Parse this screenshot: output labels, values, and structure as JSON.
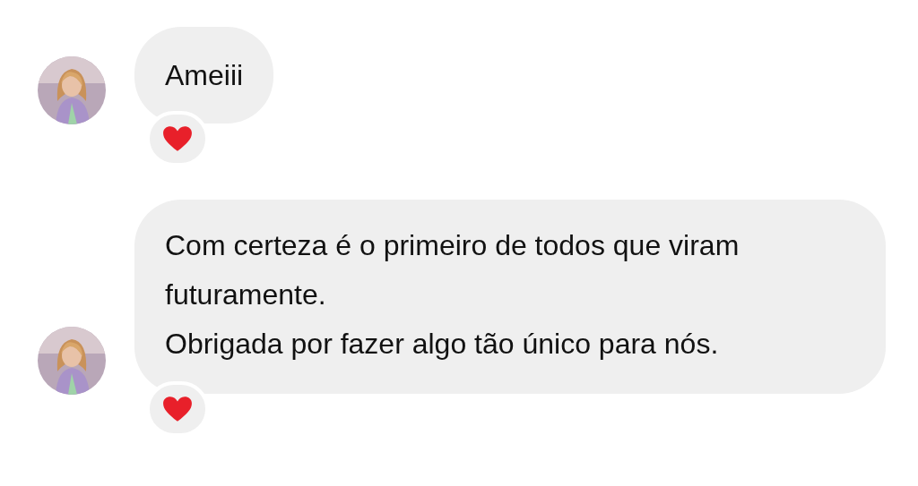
{
  "messages": [
    {
      "paragraphs": [
        "Ameiii"
      ],
      "reacted": true
    },
    {
      "paragraphs": [
        "Com certeza é o primeiro de todos que viram futuramente.",
        "Obrigada por fazer algo tão único para nós."
      ],
      "reacted": true
    }
  ]
}
